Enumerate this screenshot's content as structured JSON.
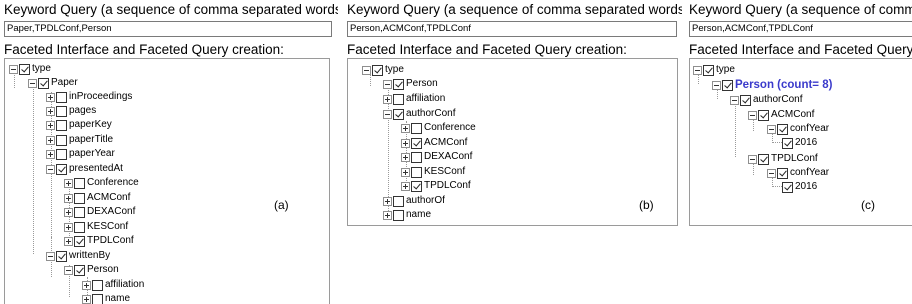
{
  "panels": {
    "a": {
      "keyword_label": "Keyword Query (a sequence of comma separated words):",
      "keyword_value": "Paper,TPDLConf,Person",
      "facet_label": "Faceted Interface and Faceted Query creation:",
      "caption": "(a)",
      "tree": [
        {
          "label": "type",
          "checked": true,
          "expander": "minus"
        },
        {
          "label": "Paper",
          "checked": true,
          "expander": "minus"
        },
        {
          "label": "inProceedings",
          "checked": false,
          "expander": "plus"
        },
        {
          "label": "pages",
          "checked": false,
          "expander": "plus"
        },
        {
          "label": "paperKey",
          "checked": false,
          "expander": "plus"
        },
        {
          "label": "paperTitle",
          "checked": false,
          "expander": "plus"
        },
        {
          "label": "paperYear",
          "checked": false,
          "expander": "plus"
        },
        {
          "label": "presentedAt",
          "checked": true,
          "expander": "minus"
        },
        {
          "label": "Conference",
          "checked": false,
          "expander": "plus"
        },
        {
          "label": "ACMConf",
          "checked": false,
          "expander": "plus"
        },
        {
          "label": "DEXAConf",
          "checked": false,
          "expander": "plus"
        },
        {
          "label": "KESConf",
          "checked": false,
          "expander": "plus"
        },
        {
          "label": "TPDLConf",
          "checked": true,
          "expander": "plus"
        },
        {
          "label": "writtenBy",
          "checked": true,
          "expander": "minus"
        },
        {
          "label": "Person",
          "checked": true,
          "expander": "minus"
        },
        {
          "label": "affiliation",
          "checked": false,
          "expander": "plus"
        },
        {
          "label": "name",
          "checked": false,
          "expander": "plus"
        }
      ]
    },
    "b": {
      "keyword_label": "Keyword Query (a sequence of comma separated words):",
      "keyword_value": "Person,ACMConf,TPDLConf",
      "facet_label": "Faceted Interface and Faceted Query creation:",
      "caption": "(b)",
      "tree": [
        {
          "label": "type",
          "checked": true,
          "expander": "minus"
        },
        {
          "label": "Person",
          "checked": true,
          "expander": "minus"
        },
        {
          "label": "affiliation",
          "checked": false,
          "expander": "plus"
        },
        {
          "label": "authorConf",
          "checked": true,
          "expander": "minus"
        },
        {
          "label": "Conference",
          "checked": false,
          "expander": "plus"
        },
        {
          "label": "ACMConf",
          "checked": true,
          "expander": "plus"
        },
        {
          "label": "DEXAConf",
          "checked": false,
          "expander": "plus"
        },
        {
          "label": "KESConf",
          "checked": false,
          "expander": "plus"
        },
        {
          "label": "TPDLConf",
          "checked": true,
          "expander": "plus"
        },
        {
          "label": "authorOf",
          "checked": false,
          "expander": "plus"
        },
        {
          "label": "name",
          "checked": false,
          "expander": "plus"
        }
      ]
    },
    "c": {
      "keyword_label": "Keyword Query (a sequence of comma",
      "keyword_value": "Person,ACMConf,TPDLConf",
      "facet_label": "Faceted Interface and Faceted Query c",
      "caption": "(c)",
      "tree": [
        {
          "label": "type",
          "checked": true,
          "expander": "minus"
        },
        {
          "label": "Person (count= 8)",
          "checked": true,
          "expander": "minus"
        },
        {
          "label": "authorConf",
          "checked": true,
          "expander": "minus"
        },
        {
          "label": "ACMConf",
          "checked": true,
          "expander": "minus"
        },
        {
          "label": "confYear",
          "checked": true,
          "expander": "minus"
        },
        {
          "label": "2016",
          "checked": true,
          "expander": "none"
        },
        {
          "label": "TPDLConf",
          "checked": true,
          "expander": "minus"
        },
        {
          "label": "confYear",
          "checked": true,
          "expander": "minus"
        },
        {
          "label": "2016",
          "checked": true,
          "expander": "none"
        }
      ]
    }
  }
}
